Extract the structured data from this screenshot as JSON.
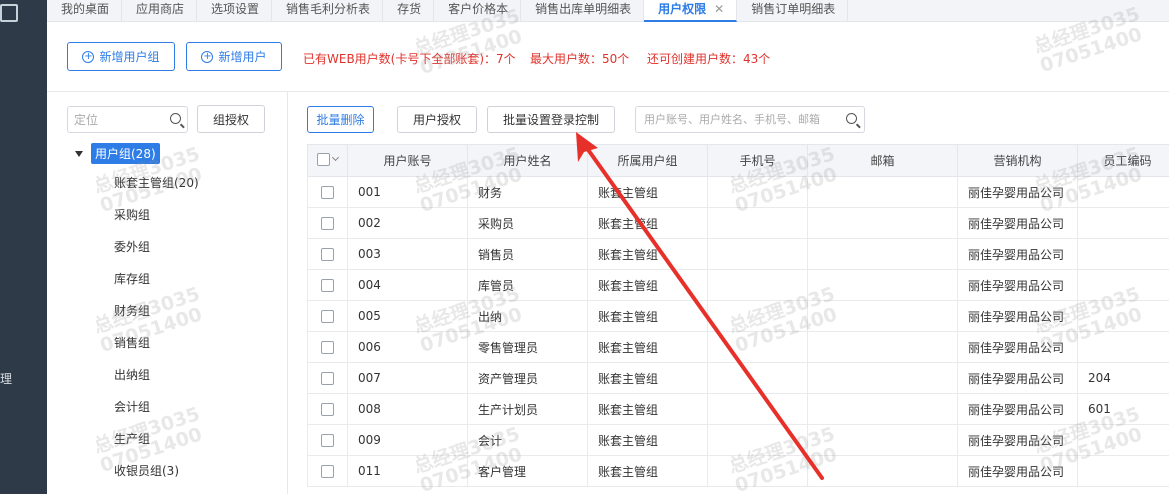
{
  "nav": {
    "side_label": "理"
  },
  "tabs": [
    {
      "label": "我的桌面",
      "active": false
    },
    {
      "label": "应用商店",
      "active": false
    },
    {
      "label": "选项设置",
      "active": false
    },
    {
      "label": "销售毛利分析表",
      "active": false
    },
    {
      "label": "存货",
      "active": false
    },
    {
      "label": "客户价格本",
      "active": false
    },
    {
      "label": "销售出库单明细表",
      "active": false
    },
    {
      "label": "用户权限",
      "active": true,
      "close": "✕"
    },
    {
      "label": "销售订单明细表",
      "active": false
    }
  ],
  "toolbar": {
    "add_group_label": "新增用户组",
    "add_user_label": "新增用户",
    "stats": {
      "web_users": "已有WEB用户数(卡号下全部账套)：7个",
      "max_users": "最大用户数：50个",
      "remaining": "还可创建用户数：43个"
    }
  },
  "tree": {
    "search_placeholder": "定位",
    "group_grant_label": "组授权",
    "root_label": "用户组(28)",
    "items": [
      "账套主管组(20)",
      "采购组",
      "委外组",
      "库存组",
      "财务组",
      "销售组",
      "出纳组",
      "会计组",
      "生产组",
      "收银员组(3)"
    ]
  },
  "main": {
    "batch_delete_label": "批量删除",
    "grant_label": "用户授权",
    "batch_login_label": "批量设置登录控制",
    "search_placeholder": "用户账号、用户姓名、手机号、邮箱",
    "columns": [
      "用户账号",
      "用户姓名",
      "所属用户组",
      "手机号",
      "邮箱",
      "营销机构",
      "员工编码"
    ],
    "rows": [
      [
        "001",
        "财务",
        "账套主管组",
        "",
        "",
        "丽佳孕婴用品公司",
        ""
      ],
      [
        "002",
        "采购员",
        "账套主管组",
        "",
        "",
        "丽佳孕婴用品公司",
        ""
      ],
      [
        "003",
        "销售员",
        "账套主管组",
        "",
        "",
        "丽佳孕婴用品公司",
        ""
      ],
      [
        "004",
        "库管员",
        "账套主管组",
        "",
        "",
        "丽佳孕婴用品公司",
        ""
      ],
      [
        "005",
        "出纳",
        "账套主管组",
        "",
        "",
        "丽佳孕婴用品公司",
        ""
      ],
      [
        "006",
        "零售管理员",
        "账套主管组",
        "",
        "",
        "丽佳孕婴用品公司",
        ""
      ],
      [
        "007",
        "资产管理员",
        "账套主管组",
        "",
        "",
        "丽佳孕婴用品公司",
        "204"
      ],
      [
        "008",
        "生产计划员",
        "账套主管组",
        "",
        "",
        "丽佳孕婴用品公司",
        "601"
      ],
      [
        "009",
        "会计",
        "账套主管组",
        "",
        "",
        "丽佳孕婴用品公司",
        ""
      ],
      [
        "011",
        "客户管理",
        "账套主管组",
        "",
        "",
        "丽佳孕婴用品公司",
        ""
      ]
    ]
  },
  "watermark": {
    "line1": "总经理3035",
    "line2": "07051400"
  },
  "colors": {
    "accent": "#2e7ce6",
    "warning_text": "#e0322c",
    "nav_bg": "#2f3a48",
    "annotation_arrow": "#e8302a"
  }
}
